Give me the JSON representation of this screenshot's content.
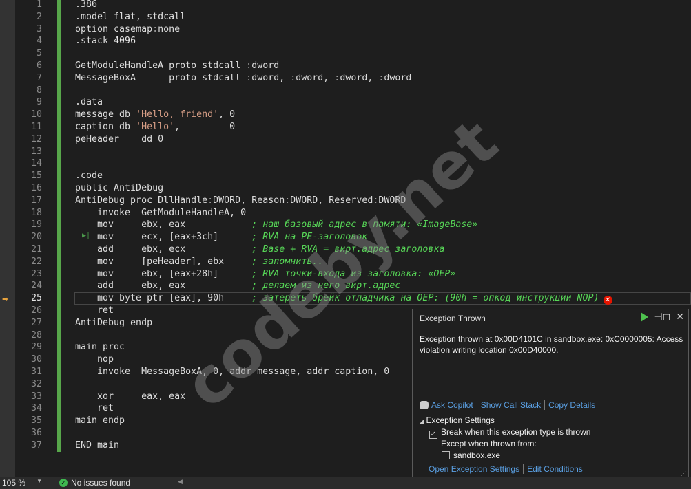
{
  "editor": {
    "current_line": 25,
    "lines": [
      [
        [
          ".386",
          ""
        ]
      ],
      [
        [
          ".model flat, stdcall",
          ""
        ]
      ],
      [
        [
          "option casemap",
          ""
        ],
        [
          ":",
          "dim"
        ],
        [
          "none",
          ""
        ]
      ],
      [
        [
          ".stack ",
          ""
        ],
        [
          "4096",
          "num"
        ]
      ],
      [],
      [
        [
          "GetModuleHandleA proto stdcall ",
          ""
        ],
        [
          ":",
          "dim"
        ],
        [
          "dword",
          ""
        ]
      ],
      [
        [
          "MessageBoxA      proto stdcall ",
          ""
        ],
        [
          ":",
          "dim"
        ],
        [
          "dword, ",
          ""
        ],
        [
          ":",
          "dim"
        ],
        [
          "dword, ",
          ""
        ],
        [
          ":",
          "dim"
        ],
        [
          "dword, ",
          ""
        ],
        [
          ":",
          "dim"
        ],
        [
          "dword",
          ""
        ]
      ],
      [],
      [
        [
          ".data",
          ""
        ]
      ],
      [
        [
          "message db ",
          ""
        ],
        [
          "'Hello, friend'",
          "str"
        ],
        [
          ", 0",
          ""
        ]
      ],
      [
        [
          "caption db ",
          ""
        ],
        [
          "'Hello'",
          "str"
        ],
        [
          ",         0",
          ""
        ]
      ],
      [
        [
          "peHeader    dd 0",
          ""
        ]
      ],
      [],
      [],
      [
        [
          ".code",
          ""
        ]
      ],
      [
        [
          "public AntiDebug",
          ""
        ]
      ],
      [
        [
          "AntiDebug proc DllHandle",
          ""
        ],
        [
          ":",
          "dim"
        ],
        [
          "DWORD, Reason",
          ""
        ],
        [
          ":",
          "dim"
        ],
        [
          "DWORD, Reserved",
          ""
        ],
        [
          ":",
          "dim"
        ],
        [
          "DWORD",
          ""
        ]
      ],
      [
        [
          "    invoke  GetModuleHandleA, 0",
          ""
        ]
      ],
      [
        [
          "    mov     ebx, eax            ",
          ""
        ],
        [
          "; наш базовый адрес в памяти: «ImageBase»",
          "cmt"
        ]
      ],
      [
        [
          "    mov     ecx, [eax+3ch]      ",
          ""
        ],
        [
          "; RVA на PE-заголовок",
          "cmt"
        ]
      ],
      [
        [
          "    add     ebx, ecx            ",
          ""
        ],
        [
          "; Base + RVA = вирт.адрес заголовка",
          "cmt"
        ]
      ],
      [
        [
          "    mov     [peHeader], ebx     ",
          ""
        ],
        [
          "; запомнить..",
          "cmt"
        ]
      ],
      [
        [
          "    mov     ebx, [eax+28h]      ",
          ""
        ],
        [
          "; RVA точки-входа из заголовка: «OEP»",
          "cmt"
        ]
      ],
      [
        [
          "    add     ebx, eax            ",
          ""
        ],
        [
          "; делаем из него вирт.адрес",
          "cmt"
        ]
      ],
      [
        [
          "    mov byte ptr [eax], 90h     ",
          ""
        ],
        [
          "; затереть брейк отладчика на OEP: (90h = опкод инструкции NOP)",
          "cmt"
        ]
      ],
      [
        [
          "    ret",
          ""
        ]
      ],
      [
        [
          "AntiDebug endp",
          ""
        ]
      ],
      [],
      [
        [
          "main proc",
          ""
        ]
      ],
      [
        [
          "    nop",
          ""
        ]
      ],
      [
        [
          "    invoke  MessageBoxA, 0, addr message, addr caption, 0",
          ""
        ]
      ],
      [],
      [
        [
          "    xor     eax, eax",
          ""
        ]
      ],
      [
        [
          "    ret",
          ""
        ]
      ],
      [
        [
          "main endp",
          ""
        ]
      ],
      [],
      [
        [
          "END main",
          ""
        ]
      ]
    ]
  },
  "watermark": "codeby.net",
  "popup": {
    "title": "Exception Thrown",
    "message": "Exception thrown at 0x00D4101C in sandbox.exe: 0xC0000005: Access violation writing location 0x00D40000.",
    "links": [
      "Ask Copilot",
      "Show Call Stack",
      "Copy Details"
    ],
    "settings_header": "Exception Settings",
    "break_label": "Break when this exception type is thrown",
    "break_checked": true,
    "except_label": "Except when thrown from:",
    "module_label": "sandbox.exe",
    "module_checked": false,
    "bottom_links": [
      "Open Exception Settings",
      "Edit Conditions"
    ]
  },
  "status": {
    "zoom": "105 %",
    "issues": "No issues found"
  },
  "colors": {
    "comment": "#57d657",
    "string": "#d69d85",
    "accent_green": "#57a64a",
    "link": "#5a9fe2",
    "error": "#e51400"
  }
}
